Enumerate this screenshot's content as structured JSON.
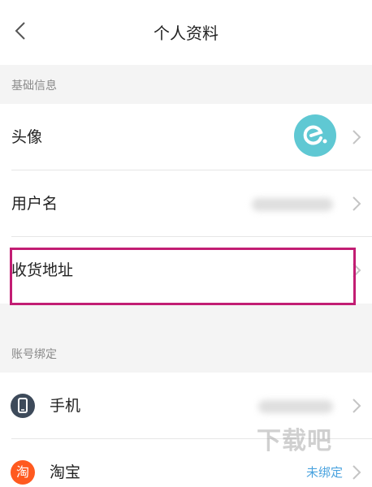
{
  "header": {
    "title": "个人资料"
  },
  "sections": {
    "basic_info": "基础信息",
    "account_binding": "账号绑定"
  },
  "rows": {
    "avatar": {
      "label": "头像"
    },
    "username": {
      "label": "用户名"
    },
    "address": {
      "label": "收货地址"
    },
    "phone": {
      "label": "手机"
    },
    "taobao": {
      "label": "淘宝",
      "status": "未绑定",
      "icon_text": "淘"
    }
  },
  "colors": {
    "highlight": "#c21d73",
    "avatar_bg": "#5fc8d3",
    "phone_icon_bg": "#3d4a5a",
    "taobao_icon_bg": "#ff5a1f",
    "status_text": "#4aa3df"
  },
  "icons": {
    "back": "chevron-left-icon",
    "chevron": "chevron-right-icon",
    "phone": "smartphone-icon",
    "taobao": "taobao-icon",
    "avatar": "eleme-logo"
  },
  "watermark": "下载吧"
}
